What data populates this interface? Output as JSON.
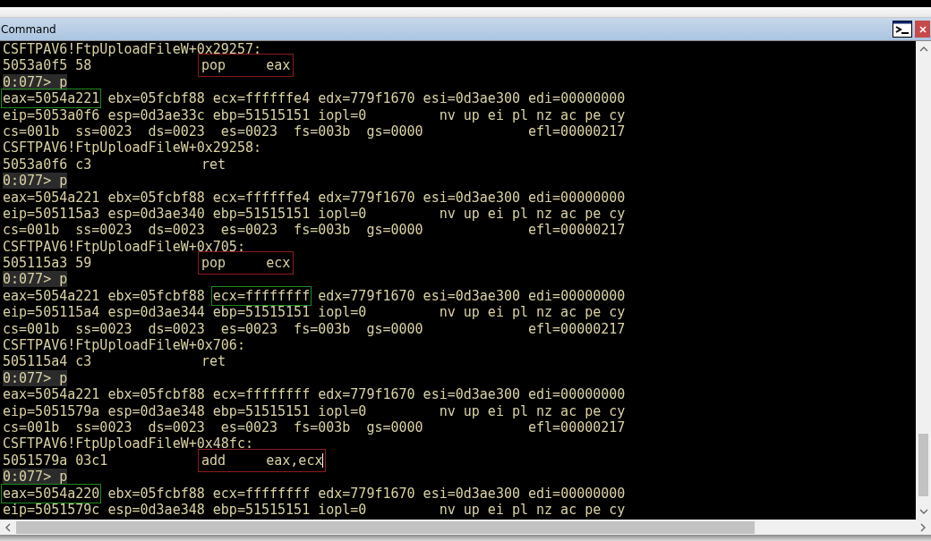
{
  "window": {
    "title": "Command"
  },
  "lines": [
    {
      "kind": "text",
      "segments": [
        {
          "text": "CSFTPAV6!FtpUploadFileW+0x29257:"
        }
      ]
    },
    {
      "kind": "disasm",
      "address": "5053a0f5 58",
      "instruction": "pop     eax",
      "color": "#8e1b1b"
    },
    {
      "kind": "prompt",
      "text": "0:077> p"
    },
    {
      "kind": "text",
      "segments": [
        {
          "text": "eax=5054a221",
          "color": "#1f8a1f"
        },
        {
          "text": "ebx=05fcbf88 ecx=ffffffe4 edx=779f1670 esi=0d3ae300 edi=00000000"
        }
      ]
    },
    {
      "kind": "text",
      "segments": [
        {
          "text": "eip=5053a0f6 esp=0d3ae33c ebp=51515151 iopl=0         nv up ei pl nz ac pe cy"
        }
      ]
    },
    {
      "kind": "text",
      "segments": [
        {
          "text": "cs=001b  ss=0023  ds=0023  es=0023  fs=003b  gs=0000             efl=00000217"
        }
      ]
    },
    {
      "kind": "text",
      "segments": [
        {
          "text": "CSFTPAV6!FtpUploadFileW+0x29258:"
        }
      ]
    },
    {
      "kind": "disasm",
      "address": "5053a0f6 c3",
      "instruction": "ret"
    },
    {
      "kind": "prompt",
      "text": "0:077> p"
    },
    {
      "kind": "text",
      "segments": [
        {
          "text": "eax=5054a221 ebx=05fcbf88 ecx=ffffffe4 edx=779f1670 esi=0d3ae300 edi=00000000"
        }
      ]
    },
    {
      "kind": "text",
      "segments": [
        {
          "text": "eip=505115a3 esp=0d3ae340 ebp=51515151 iopl=0         nv up ei pl nz ac pe cy"
        }
      ]
    },
    {
      "kind": "text",
      "segments": [
        {
          "text": "cs=001b  ss=0023  ds=0023  es=0023  fs=003b  gs=0000             efl=00000217"
        }
      ]
    },
    {
      "kind": "text",
      "segments": [
        {
          "text": "CSFTPAV6!FtpUploadFileW+0x705:"
        }
      ]
    },
    {
      "kind": "disasm",
      "address": "505115a3 59",
      "instruction": "pop     ecx",
      "color": "#8e1b1b"
    },
    {
      "kind": "prompt",
      "text": "0:077> p"
    },
    {
      "kind": "text",
      "segments": [
        {
          "text": "eax=5054a221 ebx=05fcbf88"
        },
        {
          "text": "ecx=ffffffff",
          "color": "#1f8a1f"
        },
        {
          "text": "edx=779f1670 esi=0d3ae300 edi=00000000"
        }
      ]
    },
    {
      "kind": "text",
      "segments": [
        {
          "text": "eip=505115a4 esp=0d3ae344 ebp=51515151 iopl=0         nv up ei pl nz ac pe cy"
        }
      ]
    },
    {
      "kind": "text",
      "segments": [
        {
          "text": "cs=001b  ss=0023  ds=0023  es=0023  fs=003b  gs=0000             efl=00000217"
        }
      ]
    },
    {
      "kind": "text",
      "segments": [
        {
          "text": "CSFTPAV6!FtpUploadFileW+0x706:"
        }
      ]
    },
    {
      "kind": "disasm",
      "address": "505115a4 c3",
      "instruction": "ret"
    },
    {
      "kind": "prompt",
      "text": "0:077> p"
    },
    {
      "kind": "text",
      "segments": [
        {
          "text": "eax=5054a221 ebx=05fcbf88 ecx=ffffffff edx=779f1670 esi=0d3ae300 edi=00000000"
        }
      ]
    },
    {
      "kind": "text",
      "segments": [
        {
          "text": "eip=5051579a esp=0d3ae348 ebp=51515151 iopl=0         nv up ei pl nz ac pe cy"
        }
      ]
    },
    {
      "kind": "text",
      "segments": [
        {
          "text": "cs=001b  ss=0023  ds=0023  es=0023  fs=003b  gs=0000             efl=00000217"
        }
      ]
    },
    {
      "kind": "text",
      "segments": [
        {
          "text": "CSFTPAV6!FtpUploadFileW+0x48fc:"
        }
      ]
    },
    {
      "kind": "disasm",
      "address": "5051579a 03c1",
      "instruction": "add     eax,ecx",
      "color": "#8e1b1b",
      "cursor": true
    },
    {
      "kind": "prompt",
      "text": "0:077> p"
    },
    {
      "kind": "text",
      "segments": [
        {
          "text": "eax=5054a220",
          "color": "#1f8a1f"
        },
        {
          "text": "ebx=05fcbf88 ecx=ffffffff edx=779f1670 esi=0d3ae300 edi=00000000"
        }
      ]
    },
    {
      "kind": "text",
      "segments": [
        {
          "text": "eip=5051579c esp=0d3ae348 ebp=51515151 iopl=0         nv up ei pl nz ac pe cy"
        }
      ]
    }
  ]
}
